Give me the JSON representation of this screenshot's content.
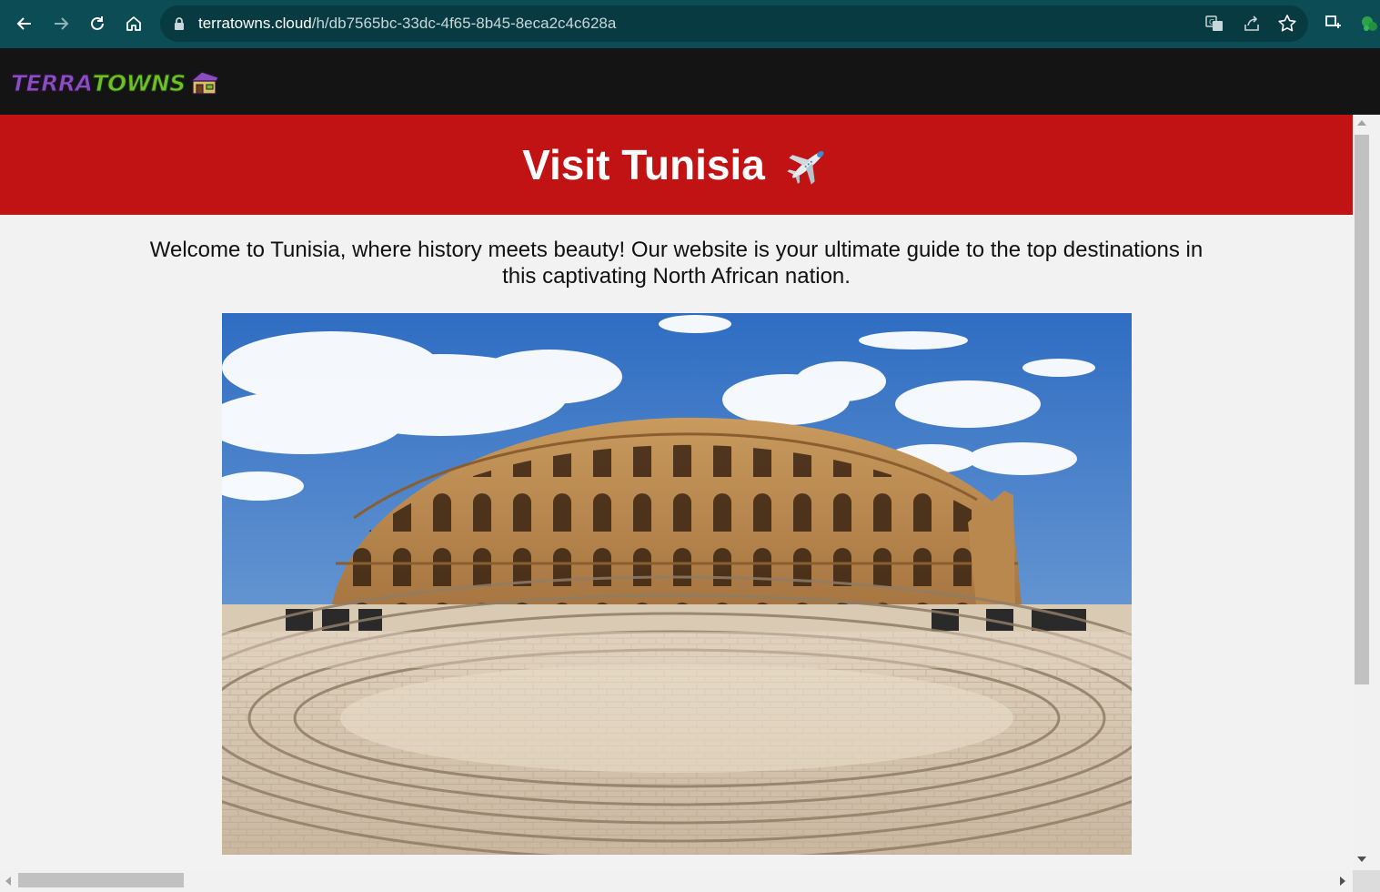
{
  "browser": {
    "url_host": "terratowns.cloud",
    "url_path": "/h/db7565bc-33dc-4f65-8b45-8eca2c4c628a",
    "icons": [
      "back-icon",
      "forward-icon",
      "reload-icon",
      "home-icon",
      "lock-icon",
      "translate-icon",
      "share-icon",
      "star-icon",
      "capture-icon",
      "extension-icon"
    ]
  },
  "site": {
    "logo_part1": "Terra",
    "logo_part2": "Towns"
  },
  "page": {
    "title": "Visit Tunisia",
    "intro": "Welcome to Tunisia, where history meets beauty! Our website is your ultimate guide to the top destinations in this captivating North African nation."
  },
  "colors": {
    "browser_chrome": "#0c4c54",
    "nav_bg": "#141414",
    "banner_red": "#c11314",
    "page_bg": "#f2f2f2"
  }
}
